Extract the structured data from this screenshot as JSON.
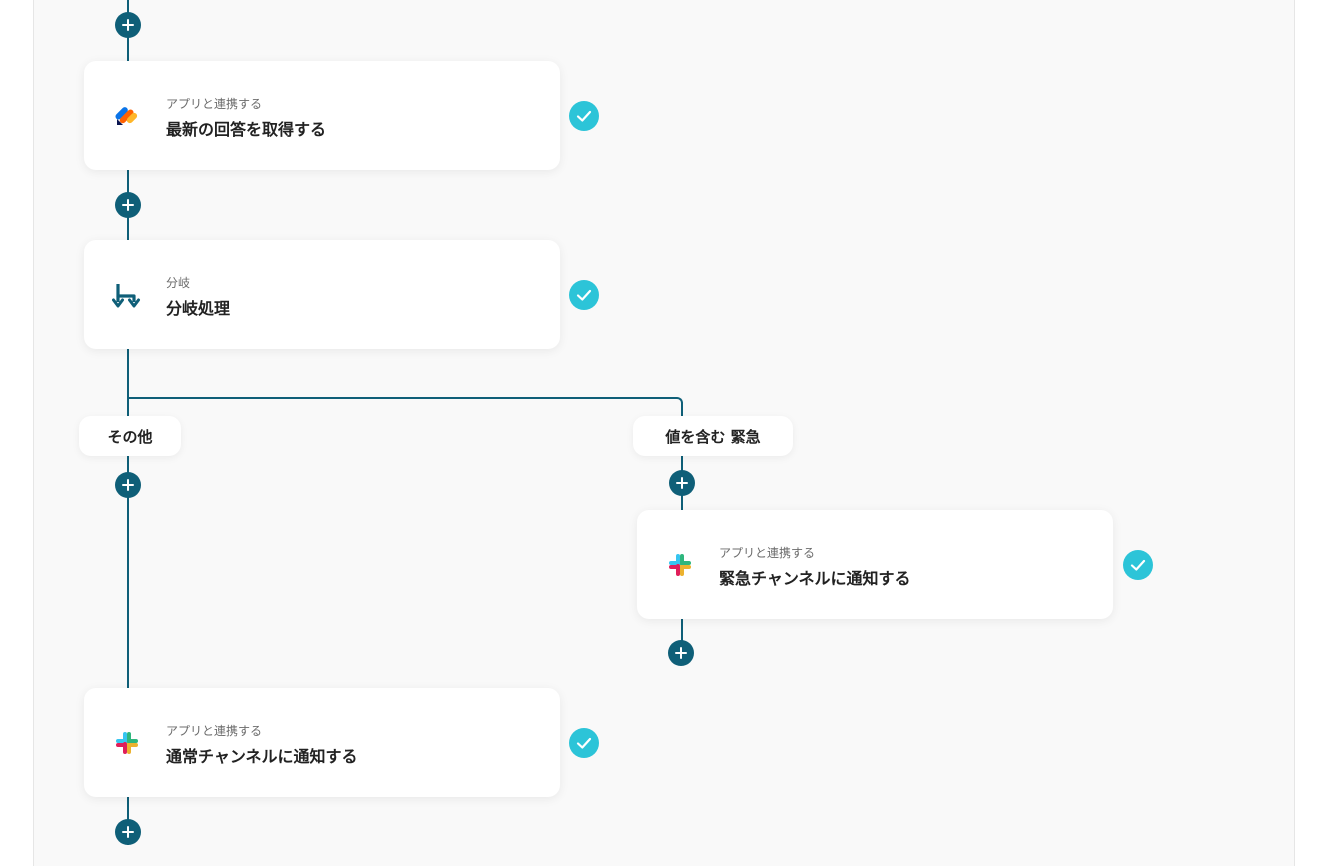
{
  "colors": {
    "flow": "#0f5f78",
    "check": "#2cc4d8",
    "canvas_bg": "#f9f9f9"
  },
  "steps": [
    {
      "icon": "jotform-icon",
      "subtitle": "アプリと連携する",
      "title": "最新の回答を取得する"
    },
    {
      "icon": "branch-icon",
      "subtitle": "分岐",
      "title": "分岐処理"
    },
    {
      "icon": "slack-icon",
      "subtitle": "アプリと連携する",
      "title": "緊急チャンネルに通知する"
    },
    {
      "icon": "slack-icon",
      "subtitle": "アプリと連携する",
      "title": "通常チャンネルに通知する"
    }
  ],
  "branches": {
    "other": "その他",
    "condition": "値を含む 緊急"
  }
}
